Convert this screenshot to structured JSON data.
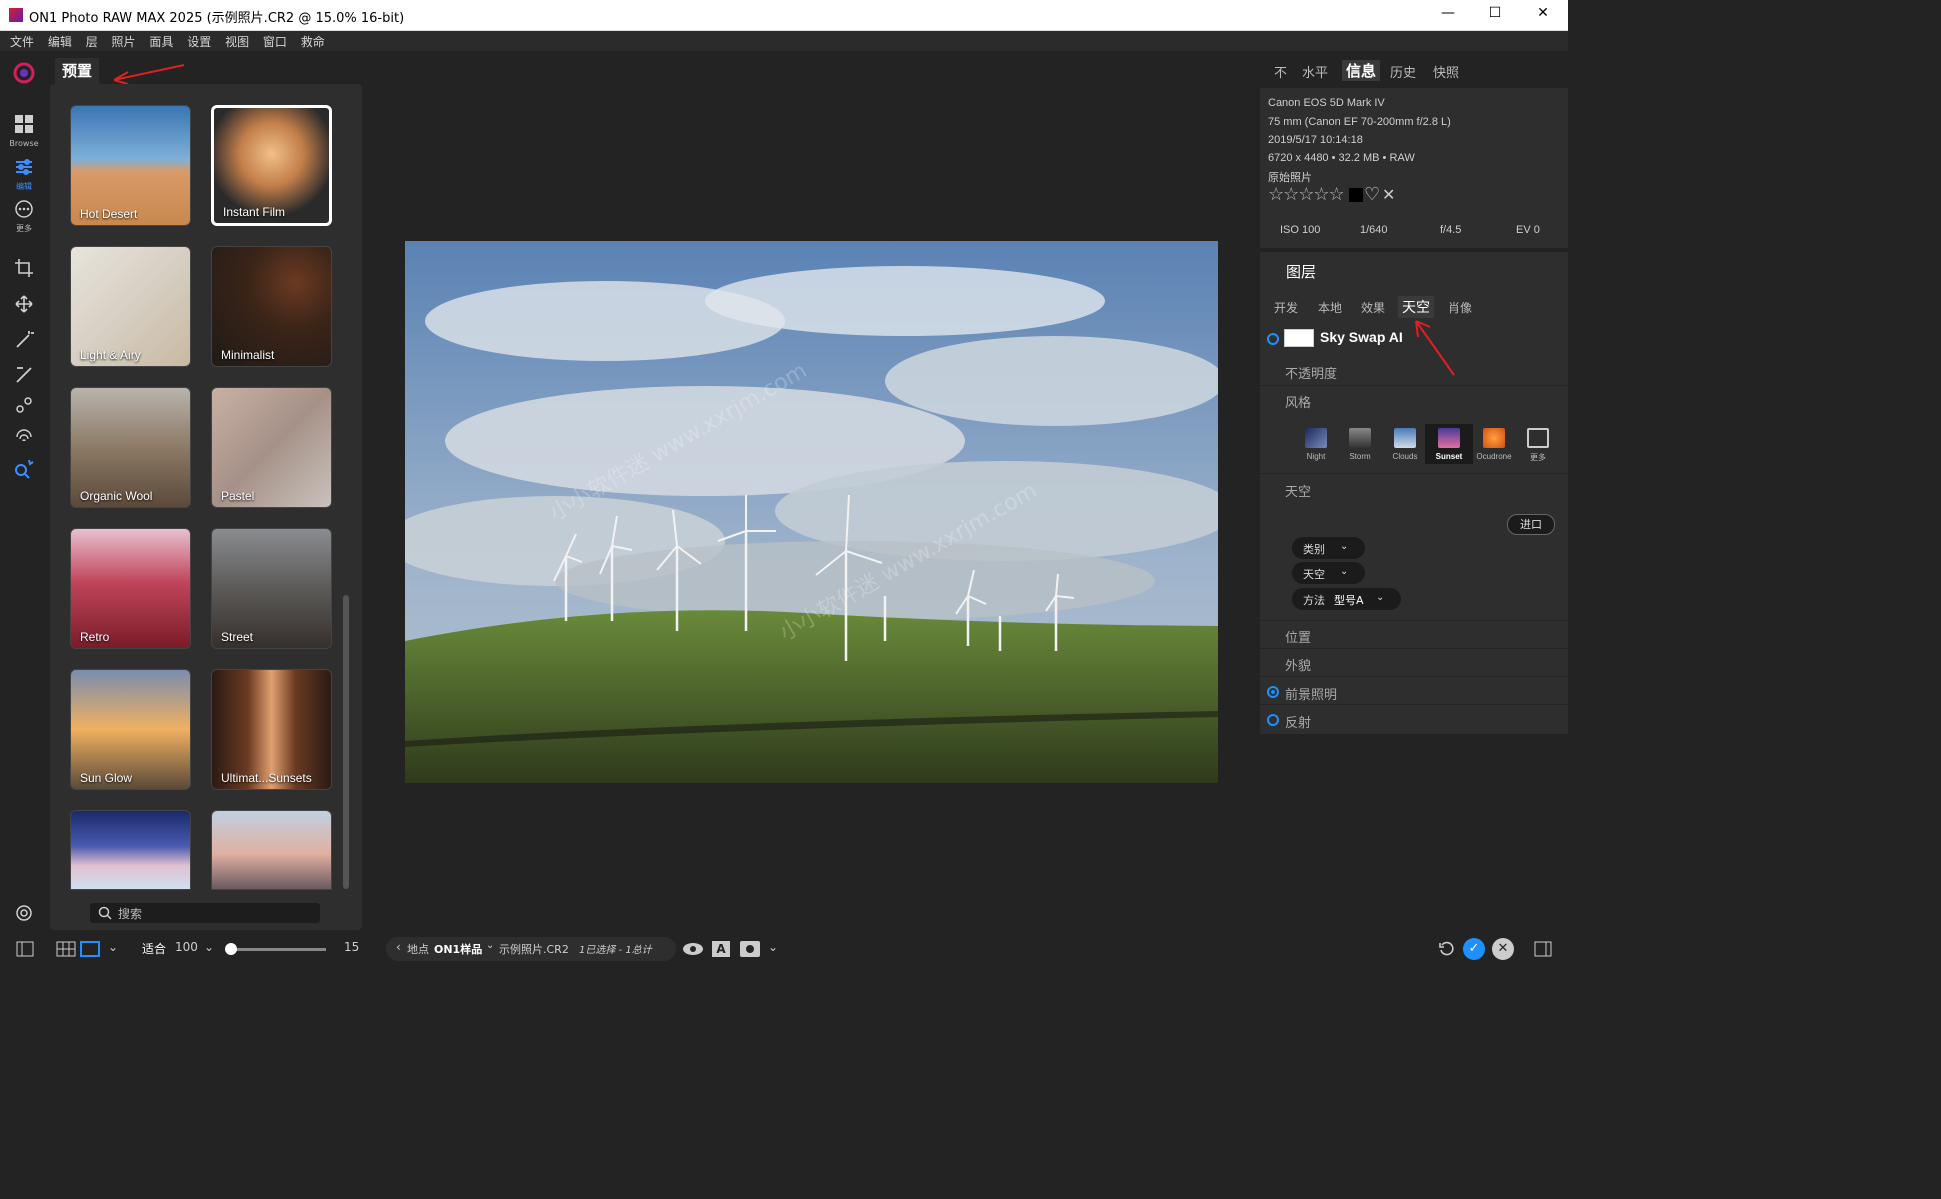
{
  "window": {
    "title": "ON1 Photo RAW MAX 2025 (示例照片.CR2 @ 15.0% 16-bit)"
  },
  "menu": [
    "文件",
    "编辑",
    "层",
    "照片",
    "面具",
    "设置",
    "视图",
    "窗口",
    "救命"
  ],
  "left_rail": {
    "browse_label": "Browse",
    "edit_label": "编辑",
    "more_label": "更多"
  },
  "presets": {
    "tab_label": "预置",
    "search_placeholder": "搜索",
    "tiles": [
      {
        "label": "Hot Desert"
      },
      {
        "label": "Instant Film"
      },
      {
        "label": "Light & Airy"
      },
      {
        "label": "Minimalist"
      },
      {
        "label": "Organic Wool"
      },
      {
        "label": "Pastel"
      },
      {
        "label": "Retro"
      },
      {
        "label": "Street"
      },
      {
        "label": "Sun Glow"
      },
      {
        "label": "Ultimat...Sunsets"
      },
      {
        "label": ""
      },
      {
        "label": ""
      }
    ]
  },
  "watermark": "小小软件迷 www.xxrjm.com",
  "right_tabs": [
    "不",
    "水平",
    "信息",
    "历史",
    "快照"
  ],
  "active_right_tab": "信息",
  "info": {
    "camera": "Canon EOS 5D Mark IV",
    "lens": "75 mm (Canon EF 70-200mm f/2.8 L)",
    "datetime": "2019/5/17  10:14:18",
    "dims": "6720 x 4480  •  32.2 MB  •  RAW",
    "original": "原始照片",
    "iso": "ISO 100",
    "shutter": "1/640",
    "aperture": "f/4.5",
    "ev": "EV 0",
    "stars": "☆☆☆☆☆",
    "heart": "♡",
    "reject": "✕"
  },
  "layers": {
    "title": "图层",
    "tabs": [
      "开发",
      "本地",
      "效果",
      "天空",
      "肖像"
    ],
    "active_tab": "天空",
    "module_name": "Sky Swap AI",
    "opacity_label": "不透明度",
    "style_label": "风格",
    "styles": [
      "Night",
      "Storm",
      "Clouds",
      "Sunset",
      "Ocudrone",
      "更多"
    ],
    "active_style": "Sunset",
    "sky_label": "天空",
    "import_button": "进口",
    "category_dd": "类别",
    "sky_dd": "天空",
    "method_label": "方法",
    "method_value": "型号A",
    "position_label": "位置",
    "appearance_label": "外貌",
    "foreground_label": "前景照明",
    "reflection_label": "反射"
  },
  "bottom": {
    "fit_label": "适合",
    "zoom_value": "100",
    "slider_value": "15",
    "slider_fraction": 0,
    "location_label": "地点",
    "folder": "ON1样品",
    "filename": "示例照片.CR2",
    "selection": "1已选择 - 1总计"
  },
  "colors": {
    "accent": "#1e90ff",
    "panel": "#2e2e2e",
    "bg": "#232323"
  }
}
